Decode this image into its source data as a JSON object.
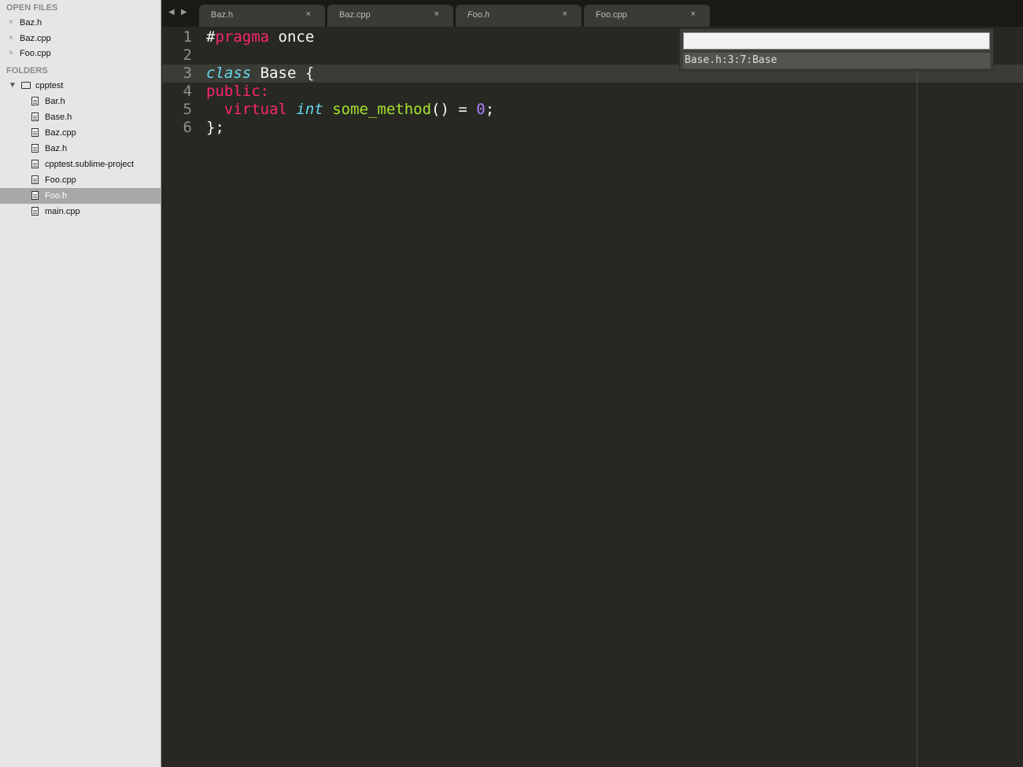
{
  "sidebar": {
    "open_files_heading": "OPEN FILES",
    "open_files": [
      {
        "label": "Baz.h"
      },
      {
        "label": "Baz.cpp"
      },
      {
        "label": "Foo.cpp"
      }
    ],
    "folders_heading": "FOLDERS",
    "folder": {
      "label": "cpptest"
    },
    "tree": [
      {
        "label": "Bar.h"
      },
      {
        "label": "Base.h"
      },
      {
        "label": "Baz.cpp"
      },
      {
        "label": "Baz.h"
      },
      {
        "label": "cpptest.sublime-project"
      },
      {
        "label": "Foo.cpp"
      },
      {
        "label": "Foo.h",
        "selected": true
      },
      {
        "label": "main.cpp"
      }
    ],
    "close_glyph": "×"
  },
  "tabs": [
    {
      "label": "Baz.h",
      "close": "×"
    },
    {
      "label": "Baz.cpp",
      "close": "×"
    },
    {
      "label": "Foo.h",
      "close": "×",
      "active": true
    },
    {
      "label": "Foo.cpp",
      "close": "×"
    }
  ],
  "nav": {
    "back": "◀",
    "forward": "▶"
  },
  "editor": {
    "line_numbers": [
      "1",
      "2",
      "3",
      "4",
      "5",
      "6"
    ],
    "lines": [
      [
        {
          "t": "#",
          "c": ""
        },
        {
          "t": "pragma",
          "c": "kw-pink"
        },
        {
          "t": " once",
          "c": ""
        }
      ],
      [],
      [
        {
          "t": "class",
          "c": "kw-blue"
        },
        {
          "t": " Base {",
          "c": ""
        }
      ],
      [
        {
          "t": "public:",
          "c": "kw-pink"
        }
      ],
      [
        {
          "t": "  ",
          "c": ""
        },
        {
          "t": "virtual",
          "c": "kw-pink"
        },
        {
          "t": " ",
          "c": ""
        },
        {
          "t": "int",
          "c": "kw-blue"
        },
        {
          "t": " ",
          "c": ""
        },
        {
          "t": "some_method",
          "c": "fn-green"
        },
        {
          "t": "() = ",
          "c": ""
        },
        {
          "t": "0",
          "c": "num"
        },
        {
          "t": ";",
          "c": ""
        }
      ],
      [
        {
          "t": "};",
          "c": ""
        }
      ]
    ]
  },
  "goto_popup": {
    "input_value": "",
    "result": "Base.h:3:7:Base"
  },
  "colors": {
    "editor_bg": "#272822",
    "keyword_pink": "#f92672",
    "keyword_blue": "#66d9ef",
    "function_green": "#a6e22e",
    "number_purple": "#ae81ff"
  }
}
